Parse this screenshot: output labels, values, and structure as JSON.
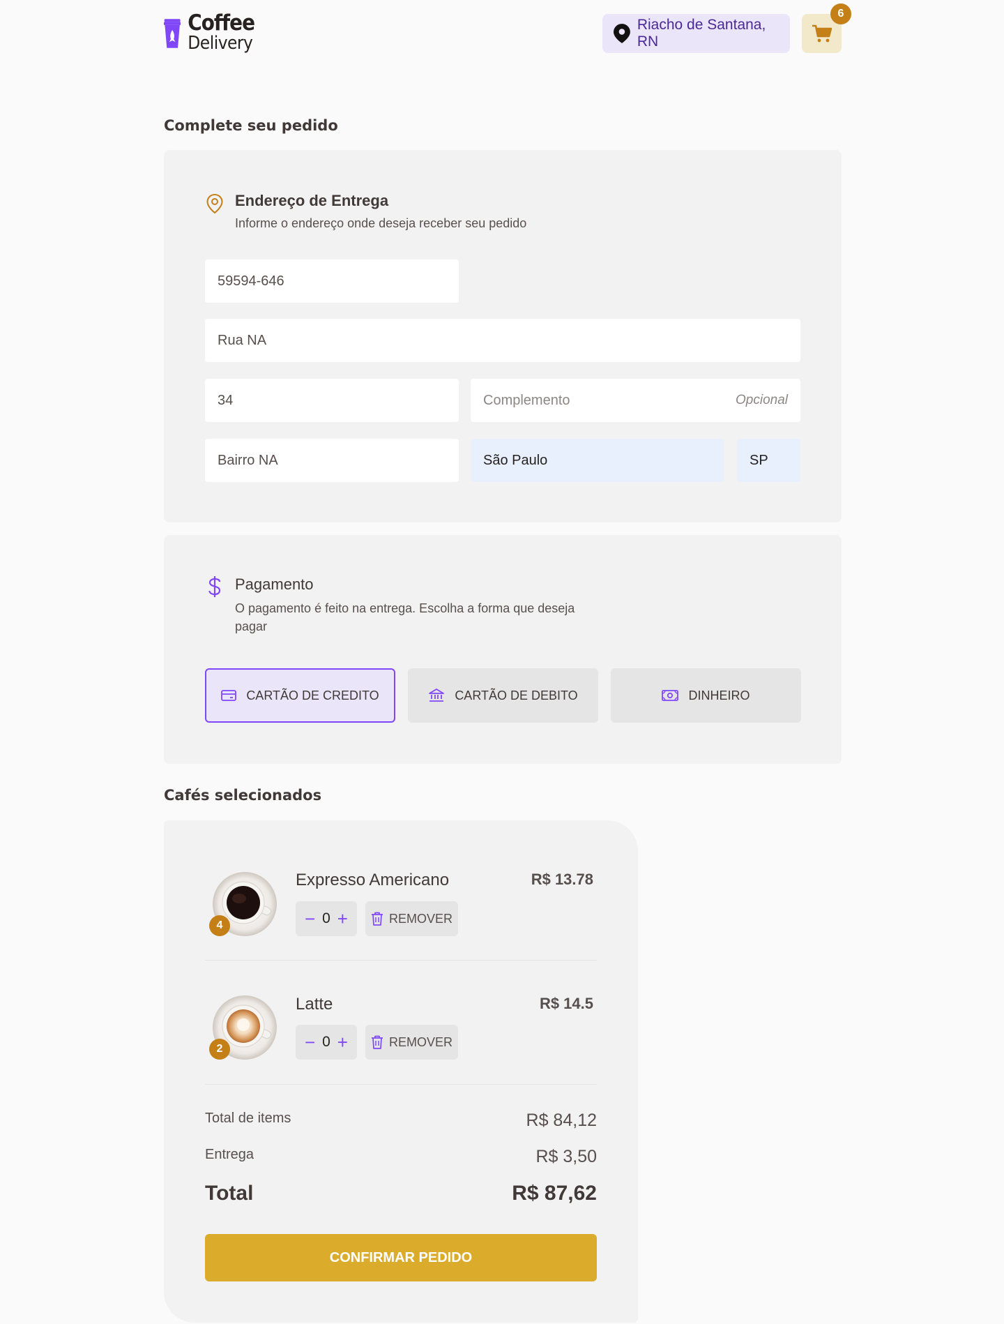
{
  "header": {
    "logo_line1": "Coffee",
    "logo_line2": "Delivery",
    "location": "Riacho de Santana, RN",
    "cart_count": "6"
  },
  "order": {
    "title": "Complete seu pedido",
    "address": {
      "heading": "Endereço de Entrega",
      "subheading": "Informe o endereço onde deseja receber seu pedido",
      "cep": "59594-646",
      "street": "Rua NA",
      "number": "34",
      "complement_placeholder": "Complemento",
      "complement_optional": "Opcional",
      "neighborhood": "Bairro NA",
      "city": "São Paulo",
      "state": "SP"
    },
    "payment": {
      "heading": "Pagamento",
      "subheading_line1": "O pagamento é feito na entrega. Escolha a forma que deseja",
      "subheading_line2": "pagar",
      "options": [
        {
          "label": "CARTÃO DE CREDITO",
          "selected": true
        },
        {
          "label": "CARTÃO DE DEBITO",
          "selected": false
        },
        {
          "label": "DINHEIRO",
          "selected": false
        }
      ]
    }
  },
  "cart": {
    "title": "Cafés selecionados",
    "items": [
      {
        "name": "Expresso Americano",
        "price": "R$ 13.78",
        "qty_badge": "4",
        "stepper_value": "0",
        "remove_label": "REMOVER"
      },
      {
        "name": "Latte",
        "price": "R$ 14.5",
        "qty_badge": "2",
        "stepper_value": "0",
        "remove_label": "REMOVER"
      }
    ],
    "summary": {
      "items_label": "Total de items",
      "items_value": "R$ 84,12",
      "delivery_label": "Entrega",
      "delivery_value": "R$ 3,50",
      "total_label": "Total",
      "total_value": "R$ 87,62"
    },
    "confirm_label": "CONFIRMAR PEDIDO"
  },
  "colors": {
    "purple": "#8047f8",
    "purple_dark": "#4b2995",
    "yellow": "#dbac2c",
    "yellow_dark": "#c47f17"
  }
}
